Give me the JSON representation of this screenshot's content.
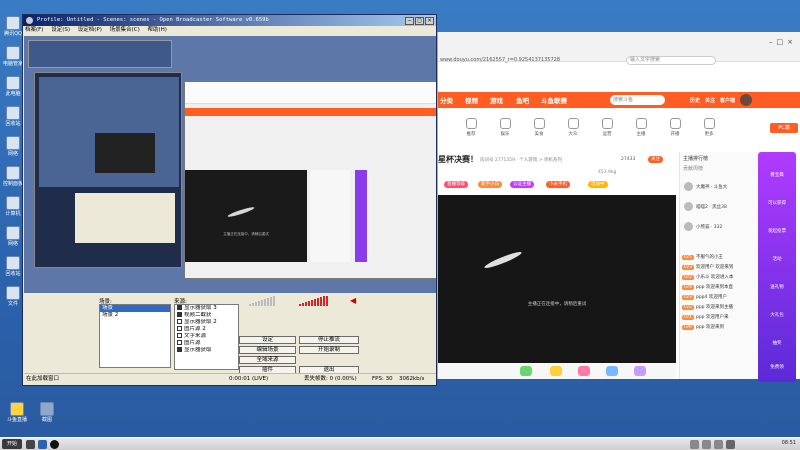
{
  "desktop": {
    "icons": [
      {
        "label": "腾讯QQ"
      },
      {
        "label": "电脑管家"
      },
      {
        "label": "此电脑"
      },
      {
        "label": "回收站"
      },
      {
        "label": "网络"
      },
      {
        "label": "控制面板"
      },
      {
        "label": "计算机"
      },
      {
        "label": "网络"
      },
      {
        "label": "回收站"
      },
      {
        "label": "文件"
      }
    ],
    "bottom_icons": [
      {
        "label": "斗鱼直播"
      },
      {
        "label": "截图"
      }
    ]
  },
  "obs": {
    "title": "Profile: Untitled - Scenes: scenes - Open Broadcaster Software v0.659b",
    "menu": [
      "档案(F)",
      "设定(S)",
      "设定档(P)",
      "场景集合(C)",
      "帮助(H)"
    ],
    "scenes_label": "场景:",
    "sources_label": "来源:",
    "scenes": [
      "场景",
      "场景 2"
    ],
    "sources": [
      {
        "label": "显示器获取 3",
        "checked": true
      },
      {
        "label": "视频二截获",
        "checked": true
      },
      {
        "label": "显示器获取 2",
        "checked": false
      },
      {
        "label": "图片源 2",
        "checked": false
      },
      {
        "label": "文字来源",
        "checked": false
      },
      {
        "label": "图片源",
        "checked": false
      },
      {
        "label": "显示器获取",
        "checked": true
      }
    ],
    "buttons": {
      "settings": "设定",
      "stop_stream": "停止推流",
      "edit_scene": "编辑场景",
      "start_recording": "开始录制",
      "global_sources": "全域来源",
      "plugins": "插件",
      "exit": "退出"
    },
    "status": {
      "left": "在此加载窗口",
      "time": "0:00:01 (LIVE)",
      "dropped": "丢失帧数: 0 (0.00%)",
      "fps": "FPS: 30",
      "bitrate": "3062kb/s"
    },
    "mini_preview": {
      "video_caption": "主播正在连接中，请稍后重试"
    }
  },
  "browser": {
    "url": "www.douyu.com/2162557_r=0.9254137135728",
    "search_placeholder": "输入文字搜索",
    "site_nav": [
      "分类",
      "视频",
      "游戏",
      "鱼吧",
      "斗鱼联赛"
    ],
    "site_search_placeholder": "搜索斗鱼",
    "pc_badge": "PC端",
    "header_right": [
      "历史",
      "关注",
      "客户端"
    ],
    "categories": [
      "推荐",
      "娱乐",
      "美食",
      "大众",
      "运营",
      "主播",
      "开播",
      "更多"
    ],
    "room_title": "星杯决赛！",
    "room_meta": "房间号 2771359  ·  个人游戏 > 单机系列",
    "room_stats": {
      "viewers": "27433",
      "fans": "453.9kg",
      "follow": "关注"
    },
    "tags": [
      "直播等级",
      "新手小白",
      "认证主播",
      "小米手机",
      "活动中"
    ],
    "video_caption": "主播正在连接中，请稍后重试",
    "chat": {
      "header": "主播排行榜",
      "subheader": "贡献周榜",
      "ranks": [
        {
          "name": "大魔神 · 斗鱼大"
        },
        {
          "name": "喵喵2 · 黑丝38"
        },
        {
          "name": "小熊猫 · 332"
        }
      ],
      "messages": [
        {
          "badge": "LV5",
          "text": "不服气的小王"
        },
        {
          "badge": "LV3",
          "text": "欢迎用户 欢迎来到"
        },
        {
          "badge": "LV2",
          "text": "小乐斗 欢迎进入本"
        },
        {
          "badge": "LV4",
          "text": "ppp 欢迎来到本直"
        },
        {
          "badge": "LV3",
          "text": "ppp4 欢迎用户"
        },
        {
          "badge": "LV2",
          "text": "ppp 欢迎来到主播"
        },
        {
          "badge": "LV1",
          "text": "ppp 欢迎用户来"
        },
        {
          "badge": "LV6",
          "text": "ppp 欢迎来到"
        }
      ]
    },
    "side_ad": [
      "看宝典",
      "可以获得",
      "发起投票",
      "活动",
      "送礼物",
      "大礼包",
      "抽奖",
      "免费领"
    ]
  },
  "taskbar": {
    "start": "开始",
    "clock": "08:51"
  }
}
